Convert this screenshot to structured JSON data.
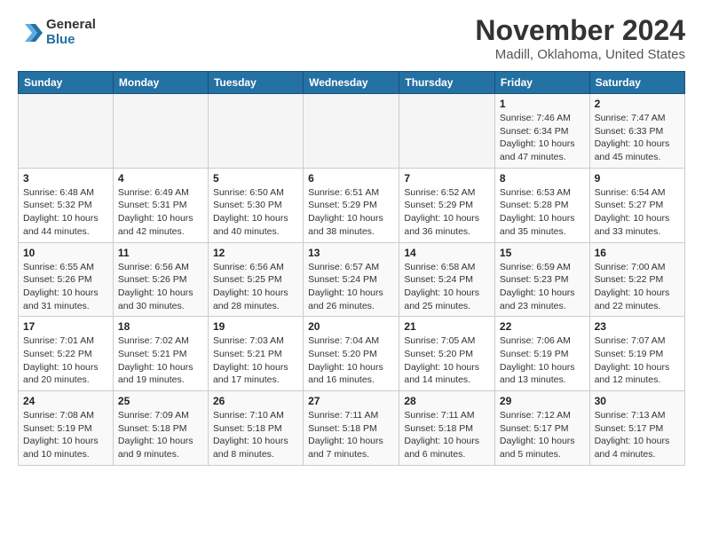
{
  "logo": {
    "general": "General",
    "blue": "Blue"
  },
  "title": "November 2024",
  "subtitle": "Madill, Oklahoma, United States",
  "weekdays": [
    "Sunday",
    "Monday",
    "Tuesday",
    "Wednesday",
    "Thursday",
    "Friday",
    "Saturday"
  ],
  "weeks": [
    [
      {
        "day": "",
        "info": ""
      },
      {
        "day": "",
        "info": ""
      },
      {
        "day": "",
        "info": ""
      },
      {
        "day": "",
        "info": ""
      },
      {
        "day": "",
        "info": ""
      },
      {
        "day": "1",
        "info": "Sunrise: 7:46 AM\nSunset: 6:34 PM\nDaylight: 10 hours and 47 minutes."
      },
      {
        "day": "2",
        "info": "Sunrise: 7:47 AM\nSunset: 6:33 PM\nDaylight: 10 hours and 45 minutes."
      }
    ],
    [
      {
        "day": "3",
        "info": "Sunrise: 6:48 AM\nSunset: 5:32 PM\nDaylight: 10 hours and 44 minutes."
      },
      {
        "day": "4",
        "info": "Sunrise: 6:49 AM\nSunset: 5:31 PM\nDaylight: 10 hours and 42 minutes."
      },
      {
        "day": "5",
        "info": "Sunrise: 6:50 AM\nSunset: 5:30 PM\nDaylight: 10 hours and 40 minutes."
      },
      {
        "day": "6",
        "info": "Sunrise: 6:51 AM\nSunset: 5:29 PM\nDaylight: 10 hours and 38 minutes."
      },
      {
        "day": "7",
        "info": "Sunrise: 6:52 AM\nSunset: 5:29 PM\nDaylight: 10 hours and 36 minutes."
      },
      {
        "day": "8",
        "info": "Sunrise: 6:53 AM\nSunset: 5:28 PM\nDaylight: 10 hours and 35 minutes."
      },
      {
        "day": "9",
        "info": "Sunrise: 6:54 AM\nSunset: 5:27 PM\nDaylight: 10 hours and 33 minutes."
      }
    ],
    [
      {
        "day": "10",
        "info": "Sunrise: 6:55 AM\nSunset: 5:26 PM\nDaylight: 10 hours and 31 minutes."
      },
      {
        "day": "11",
        "info": "Sunrise: 6:56 AM\nSunset: 5:26 PM\nDaylight: 10 hours and 30 minutes."
      },
      {
        "day": "12",
        "info": "Sunrise: 6:56 AM\nSunset: 5:25 PM\nDaylight: 10 hours and 28 minutes."
      },
      {
        "day": "13",
        "info": "Sunrise: 6:57 AM\nSunset: 5:24 PM\nDaylight: 10 hours and 26 minutes."
      },
      {
        "day": "14",
        "info": "Sunrise: 6:58 AM\nSunset: 5:24 PM\nDaylight: 10 hours and 25 minutes."
      },
      {
        "day": "15",
        "info": "Sunrise: 6:59 AM\nSunset: 5:23 PM\nDaylight: 10 hours and 23 minutes."
      },
      {
        "day": "16",
        "info": "Sunrise: 7:00 AM\nSunset: 5:22 PM\nDaylight: 10 hours and 22 minutes."
      }
    ],
    [
      {
        "day": "17",
        "info": "Sunrise: 7:01 AM\nSunset: 5:22 PM\nDaylight: 10 hours and 20 minutes."
      },
      {
        "day": "18",
        "info": "Sunrise: 7:02 AM\nSunset: 5:21 PM\nDaylight: 10 hours and 19 minutes."
      },
      {
        "day": "19",
        "info": "Sunrise: 7:03 AM\nSunset: 5:21 PM\nDaylight: 10 hours and 17 minutes."
      },
      {
        "day": "20",
        "info": "Sunrise: 7:04 AM\nSunset: 5:20 PM\nDaylight: 10 hours and 16 minutes."
      },
      {
        "day": "21",
        "info": "Sunrise: 7:05 AM\nSunset: 5:20 PM\nDaylight: 10 hours and 14 minutes."
      },
      {
        "day": "22",
        "info": "Sunrise: 7:06 AM\nSunset: 5:19 PM\nDaylight: 10 hours and 13 minutes."
      },
      {
        "day": "23",
        "info": "Sunrise: 7:07 AM\nSunset: 5:19 PM\nDaylight: 10 hours and 12 minutes."
      }
    ],
    [
      {
        "day": "24",
        "info": "Sunrise: 7:08 AM\nSunset: 5:19 PM\nDaylight: 10 hours and 10 minutes."
      },
      {
        "day": "25",
        "info": "Sunrise: 7:09 AM\nSunset: 5:18 PM\nDaylight: 10 hours and 9 minutes."
      },
      {
        "day": "26",
        "info": "Sunrise: 7:10 AM\nSunset: 5:18 PM\nDaylight: 10 hours and 8 minutes."
      },
      {
        "day": "27",
        "info": "Sunrise: 7:11 AM\nSunset: 5:18 PM\nDaylight: 10 hours and 7 minutes."
      },
      {
        "day": "28",
        "info": "Sunrise: 7:11 AM\nSunset: 5:18 PM\nDaylight: 10 hours and 6 minutes."
      },
      {
        "day": "29",
        "info": "Sunrise: 7:12 AM\nSunset: 5:17 PM\nDaylight: 10 hours and 5 minutes."
      },
      {
        "day": "30",
        "info": "Sunrise: 7:13 AM\nSunset: 5:17 PM\nDaylight: 10 hours and 4 minutes."
      }
    ]
  ]
}
